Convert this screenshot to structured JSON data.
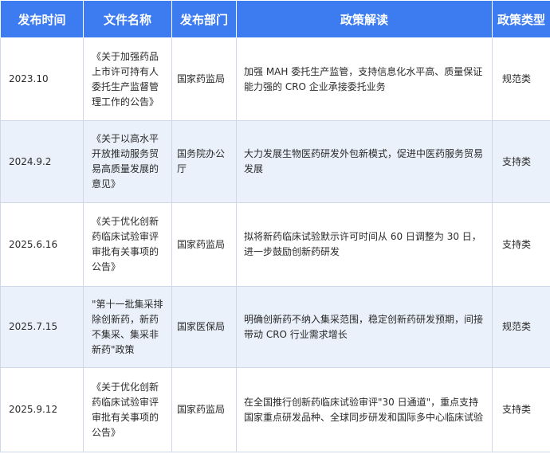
{
  "table": {
    "headers": [
      "发布时间",
      "文件名称",
      "发布部门",
      "政策解读",
      "政策类型"
    ],
    "rows": [
      {
        "date": "2023.10",
        "name": "《关于加强药品上市许可持有人委托生产监督管理工作的公告》",
        "dept": "国家药监局",
        "desc": "加强 MAH 委托生产监管，支持信息化水平高、质量保证能力强的 CRO 企业承接委托业务",
        "type": "规范类"
      },
      {
        "date": "2024.9.2",
        "name": "《关于以高水平开放推动服务贸易高质量发展的意见》",
        "dept": "国务院办公厅",
        "desc": "大力发展生物医药研发外包新模式，促进中医药服务贸易发展",
        "type": "支持类"
      },
      {
        "date": "2025.6.16",
        "name": "《关于优化创新药临床试验审评审批有关事项的公告》",
        "dept": "国家药监局",
        "desc": "拟将新药临床试验默示许可时间从 60 日调整为 30 日，进一步鼓励创新药研发",
        "type": "支持类"
      },
      {
        "date": "2025.7.15",
        "name": "\"第十一批集采排除创新药，新药不集采、集采非新药\"政策",
        "dept": "国家医保局",
        "desc": "明确创新药不纳入集采范围，稳定创新药研发预期，间接带动 CRO 行业需求增长",
        "type": "规范类"
      },
      {
        "date": "2025.9.12",
        "name": "《关于优化创新药临床试验审评审批有关事项的公告》",
        "dept": "国家药监局",
        "desc": "在全国推行创新药临床试验审评\"30 日通道\"，重点支持国家重点研发品种、全球同步研发和国际多中心临床试验",
        "type": "支持类"
      }
    ]
  }
}
